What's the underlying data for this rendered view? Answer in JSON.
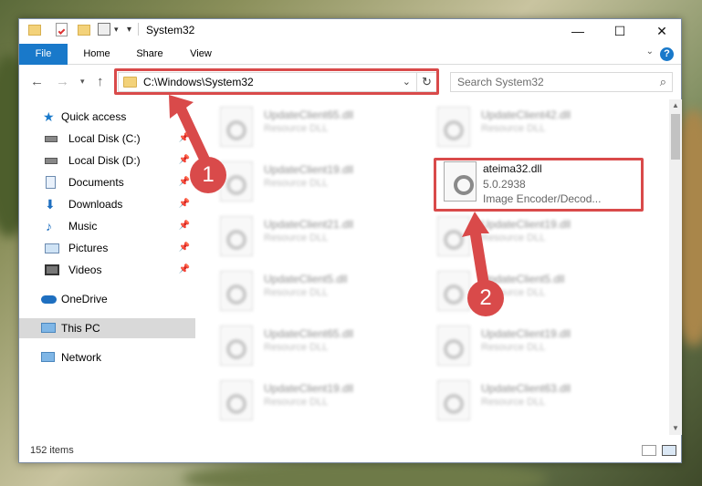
{
  "window": {
    "title": "System32",
    "controls": {
      "minimize": "—",
      "maximize": "☐",
      "close": "✕"
    }
  },
  "ribbon": {
    "tabs": [
      "File",
      "Home",
      "Share",
      "View"
    ],
    "help": "?"
  },
  "nav": {
    "address": "C:\\Windows\\System32",
    "search_placeholder": "Search System32"
  },
  "sidebar": {
    "items": [
      {
        "label": "Quick access",
        "icon": "star-icon"
      },
      {
        "label": "Local Disk (C:)",
        "icon": "drive-icon",
        "pinned": true
      },
      {
        "label": "Local Disk (D:)",
        "icon": "drive-icon",
        "pinned": true
      },
      {
        "label": "Documents",
        "icon": "documents-icon",
        "pinned": true
      },
      {
        "label": "Downloads",
        "icon": "downloads-icon",
        "pinned": true
      },
      {
        "label": "Music",
        "icon": "music-icon",
        "pinned": true
      },
      {
        "label": "Pictures",
        "icon": "pictures-icon",
        "pinned": true
      },
      {
        "label": "Videos",
        "icon": "videos-icon",
        "pinned": true
      },
      {
        "label": "OneDrive",
        "icon": "cloud-icon"
      },
      {
        "label": "This PC",
        "icon": "pc-icon",
        "selected": true
      },
      {
        "label": "Network",
        "icon": "network-icon"
      }
    ]
  },
  "files": {
    "blurred": [
      {
        "name": "UpdateClient65.dll",
        "type": "Resource DLL"
      },
      {
        "name": "UpdateClient42.dll",
        "type": "Resource DLL"
      },
      {
        "name": "UpdateClient19.dll",
        "type": "Resource DLL"
      },
      {
        "name": "UpdateClient21.dll",
        "type": "Resource DLL"
      },
      {
        "name": "UpdateClient19.dll",
        "type": "Resource DLL"
      },
      {
        "name": "UpdateClient5.dll",
        "type": "Resource DLL"
      },
      {
        "name": "UpdateClient5.dll",
        "type": "Resource DLL"
      },
      {
        "name": "UpdateClient65.dll",
        "type": "Resource DLL"
      },
      {
        "name": "UpdateClient19.dll",
        "type": "Resource DLL"
      },
      {
        "name": "UpdateClient19.dll",
        "type": "Resource DLL"
      },
      {
        "name": "UpdateClient63.dll",
        "type": "Resource DLL"
      }
    ],
    "featured": {
      "name": "ateima32.dll",
      "version": "5.0.2938",
      "description": "Image Encoder/Decod..."
    }
  },
  "status": {
    "item_count": "152 items"
  },
  "annotations": {
    "step1": "1",
    "step2": "2",
    "color": "#d94a4a"
  },
  "colors": {
    "accent": "#1979ca",
    "highlight": "#d94a4a"
  }
}
